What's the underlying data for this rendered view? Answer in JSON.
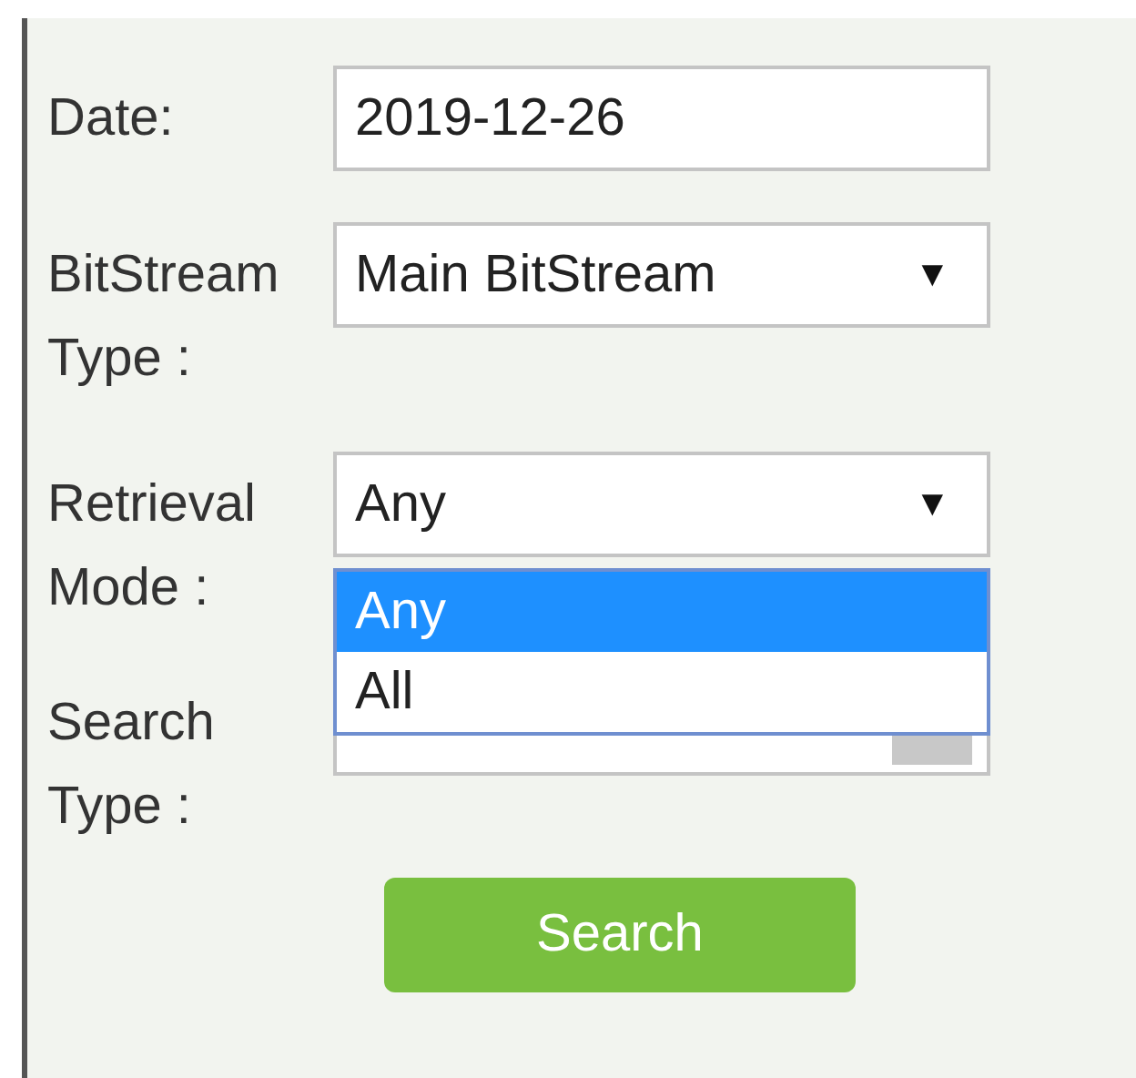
{
  "fields": [
    {
      "kind": "text",
      "label": "Date:",
      "value": "2019-12-26"
    },
    {
      "kind": "select",
      "label": "BitStream Type :",
      "value": "Main BitStream",
      "arrow": "▼"
    },
    {
      "kind": "select",
      "label": "Retrieval Mode :",
      "value": "Any",
      "arrow": "▼",
      "expanded": true,
      "options": [
        {
          "label": "Any",
          "selected": true
        },
        {
          "label": "All",
          "selected": false
        }
      ]
    },
    {
      "kind": "covered",
      "label": "Search Type :"
    }
  ],
  "search_button": "Search"
}
